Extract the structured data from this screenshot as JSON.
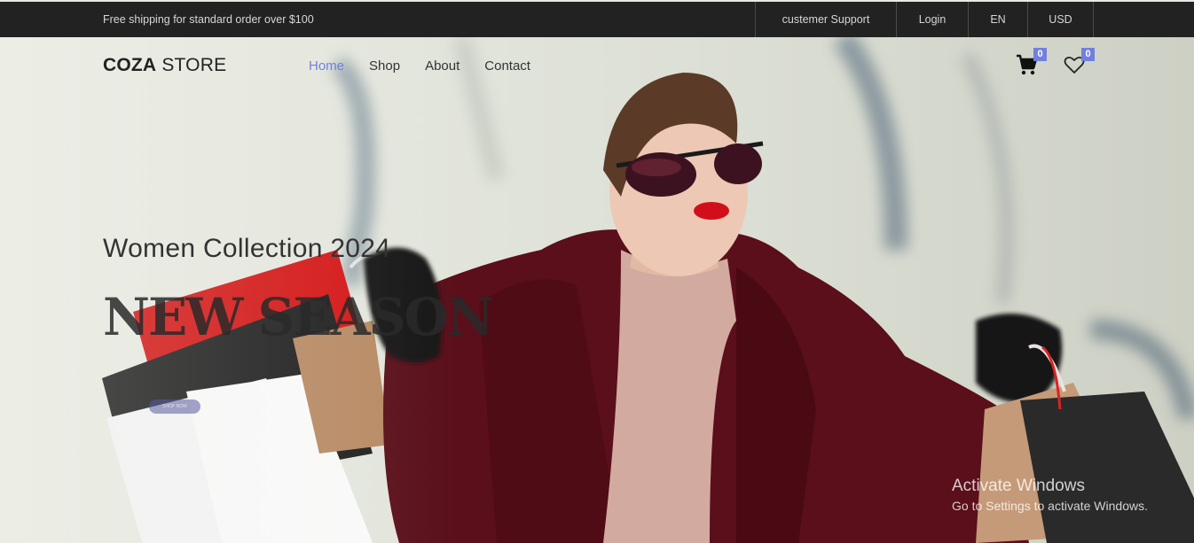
{
  "topbar": {
    "promo": "Free shipping for standard order over $100",
    "support": "custemer Support",
    "login": "Login",
    "language": "EN",
    "currency": "USD"
  },
  "header": {
    "logo_bold": "COZA",
    "logo_rest": " STORE",
    "nav": [
      {
        "label": "Home",
        "active": true
      },
      {
        "label": "Shop"
      },
      {
        "label": "About"
      },
      {
        "label": "Contact"
      }
    ],
    "cart_count": "0",
    "wishlist_count": "0",
    "cart_icon": "shopping-cart-icon",
    "wishlist_icon": "heart-icon"
  },
  "hero": {
    "subtitle": "Women Collection 2024",
    "headline": "NEW SEASON",
    "button": "SHOP NOW",
    "image": "woman-with-shopping-bags"
  },
  "watermark": {
    "line1": "Activate Windows",
    "line2": "Go to Settings to activate Windows."
  },
  "colors": {
    "accent": "#717fe0",
    "topbar_bg": "#222222",
    "coat": "#5a0f1a",
    "lips": "#d10f1a"
  }
}
